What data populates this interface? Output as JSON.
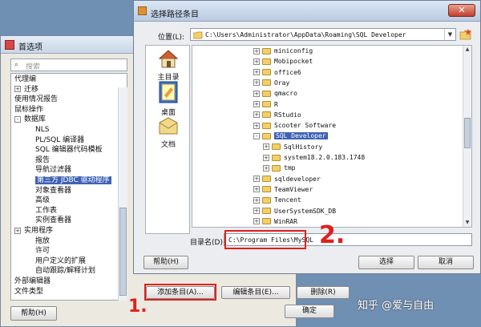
{
  "preferences": {
    "title": "首选项",
    "search_placeholder": "搜索",
    "tree": [
      {
        "label": "代理编",
        "level": 0,
        "expander": ""
      },
      {
        "label": "迁移",
        "level": 0,
        "expander": "+"
      },
      {
        "label": "使用情况报告",
        "level": 0,
        "expander": ""
      },
      {
        "label": "鼠标操作",
        "level": 0,
        "expander": ""
      },
      {
        "label": "数据库",
        "level": 0,
        "expander": "-"
      },
      {
        "label": "NLS",
        "level": 1,
        "expander": ""
      },
      {
        "label": "PL/SQL 编译器",
        "level": 1,
        "expander": ""
      },
      {
        "label": "SQL 编辑器代码模板",
        "level": 1,
        "expander": ""
      },
      {
        "label": "报告",
        "level": 1,
        "expander": ""
      },
      {
        "label": "导航过滤器",
        "level": 1,
        "expander": ""
      },
      {
        "label": "第三方 JDBC 驱动程序",
        "level": 1,
        "expander": "",
        "selected": true
      },
      {
        "label": "对象查看器",
        "level": 1,
        "expander": ""
      },
      {
        "label": "高级",
        "level": 1,
        "expander": ""
      },
      {
        "label": "工作表",
        "level": 1,
        "expander": ""
      },
      {
        "label": "实例查看器",
        "level": 1,
        "expander": ""
      },
      {
        "label": "实用程序",
        "level": 0,
        "expander": "+"
      },
      {
        "label": "拖放",
        "level": 1,
        "expander": ""
      },
      {
        "label": "许可",
        "level": 1,
        "expander": ""
      },
      {
        "label": "用户定义的扩展",
        "level": 1,
        "expander": ""
      },
      {
        "label": "自动跟踪/解释计划",
        "level": 1,
        "expander": ""
      },
      {
        "label": "外部编辑器",
        "level": 0,
        "expander": ""
      },
      {
        "label": "文件类型",
        "level": 0,
        "expander": ""
      }
    ],
    "help_label": "帮助(H)",
    "ok_label": "确定",
    "add_entry_label": "添加条目(A)...",
    "edit_entry_label": "编辑条目(E)...",
    "delete_label": "删除(R)"
  },
  "dialog": {
    "title": "选择路径条目",
    "close_glyph": "✕",
    "location_label": "位置(L):",
    "location_value": "C:\\Users\\Administrator\\AppData\\Roaming\\SQL Developer",
    "places": [
      {
        "label": "主目录",
        "icon": "home-icon"
      },
      {
        "label": "桌面",
        "icon": "desktop-icon"
      },
      {
        "label": "文档",
        "icon": "documents-icon"
      }
    ],
    "files": [
      {
        "name": "miniconfig",
        "indent": 0,
        "expander": "+",
        "selected": false
      },
      {
        "name": "Mobipocket",
        "indent": 0,
        "expander": "+",
        "selected": false
      },
      {
        "name": "office6",
        "indent": 0,
        "expander": "+",
        "selected": false
      },
      {
        "name": "Oray",
        "indent": 0,
        "expander": "+",
        "selected": false
      },
      {
        "name": "qmacro",
        "indent": 0,
        "expander": "+",
        "selected": false
      },
      {
        "name": "R",
        "indent": 0,
        "expander": "+",
        "selected": false
      },
      {
        "name": "RStudio",
        "indent": 0,
        "expander": "+",
        "selected": false
      },
      {
        "name": "Scooter Software",
        "indent": 0,
        "expander": "+",
        "selected": false
      },
      {
        "name": "SQL Developer",
        "indent": 0,
        "expander": "-",
        "selected": true
      },
      {
        "name": "SqlHistory",
        "indent": 1,
        "expander": "+",
        "selected": false
      },
      {
        "name": "system18.2.0.183.1748",
        "indent": 1,
        "expander": "+",
        "selected": false
      },
      {
        "name": "tmp",
        "indent": 1,
        "expander": "+",
        "selected": false
      },
      {
        "name": "sqldeveloper",
        "indent": 0,
        "expander": "+",
        "selected": false
      },
      {
        "name": "TeamViewer",
        "indent": 0,
        "expander": "+",
        "selected": false
      },
      {
        "name": "Tencent",
        "indent": 0,
        "expander": "+",
        "selected": false
      },
      {
        "name": "UserSystemSDK_DB",
        "indent": 0,
        "expander": "+",
        "selected": false
      },
      {
        "name": "WinRAR",
        "indent": 0,
        "expander": "+",
        "selected": false
      }
    ],
    "dir_label": "目录名(D):",
    "dir_value": "C:\\Program Files\\MySQL",
    "help_label": "帮助(H)",
    "select_label": "选择",
    "cancel_label": "取消"
  },
  "annotations": {
    "step1": "1.",
    "step2": "2.",
    "color": "#e0201c"
  },
  "watermark": "知乎 @爱与自由"
}
